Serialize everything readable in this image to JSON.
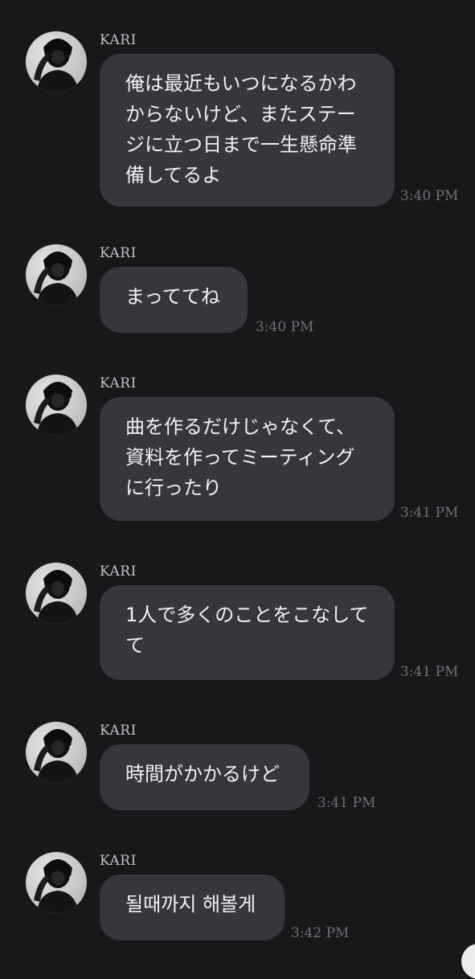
{
  "messages": [
    {
      "sender": "KARI",
      "text": "俺は最近もいつになるかわからないけど、またステージに立つ日まで一生懸命準備してるよ",
      "time": "3:40 PM"
    },
    {
      "sender": "KARI",
      "text": "まっててね",
      "time": "3:40 PM"
    },
    {
      "sender": "KARI",
      "text": "曲を作るだけじゃなくて、資料を作ってミーティングに行ったり",
      "time": "3:41 PM"
    },
    {
      "sender": "KARI",
      "text": "1人で多くのことをこなしてて",
      "time": "3:41 PM"
    },
    {
      "sender": "KARI",
      "text": "時間がかかるけど",
      "time": "3:41 PM"
    },
    {
      "sender": "KARI",
      "text": "될때까지 해볼게",
      "time": "3:42 PM"
    }
  ],
  "colors": {
    "background": "#18181b",
    "bubble": "#36373d",
    "message_text": "#f2f2f4",
    "sender_text": "#c2c2c6",
    "timestamp_text": "#6f6f74"
  },
  "icons": {
    "avatar": "profile-photo-avatar",
    "scroll_button": "scroll-down-button"
  }
}
